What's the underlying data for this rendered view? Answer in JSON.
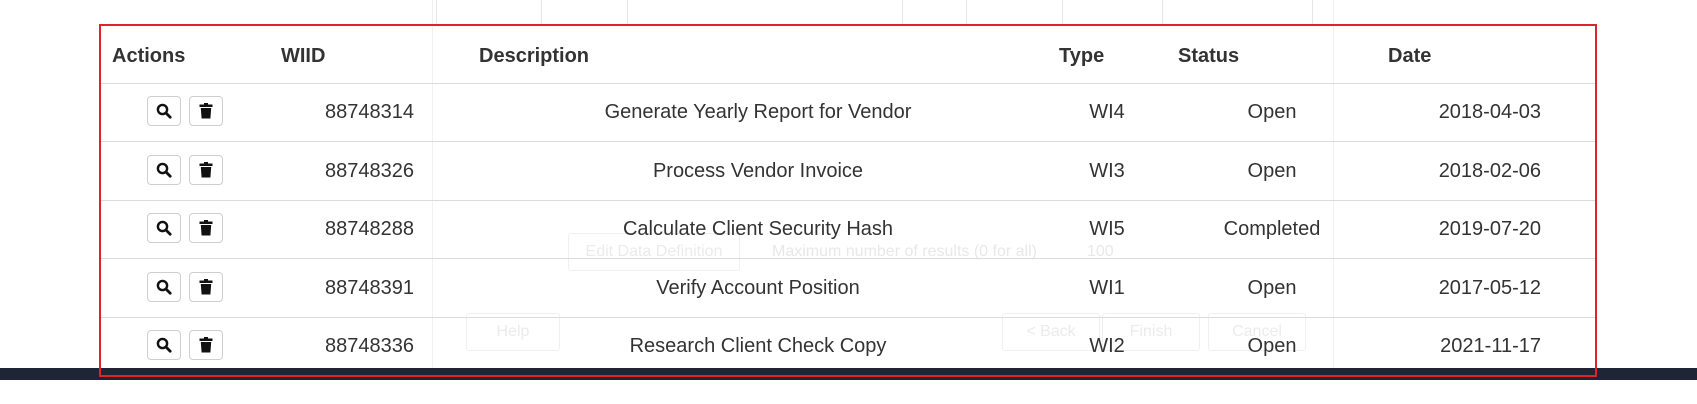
{
  "table": {
    "headers": {
      "actions": "Actions",
      "wiid": "WIID",
      "description": "Description",
      "type": "Type",
      "status": "Status",
      "date": "Date"
    },
    "rows": [
      {
        "wiid": "88748314",
        "description": "Generate Yearly Report for Vendor",
        "type": "WI4",
        "status": "Open",
        "date": "2018-04-03"
      },
      {
        "wiid": "88748326",
        "description": "Process Vendor Invoice",
        "type": "WI3",
        "status": "Open",
        "date": "2018-02-06"
      },
      {
        "wiid": "88748288",
        "description": "Calculate Client Security Hash",
        "type": "WI5",
        "status": "Completed",
        "date": "2019-07-20"
      },
      {
        "wiid": "88748391",
        "description": "Verify Account Position",
        "type": "WI1",
        "status": "Open",
        "date": "2017-05-12"
      },
      {
        "wiid": "88748336",
        "description": "Research Client Check Copy",
        "type": "WI2",
        "status": "Open",
        "date": "2021-11-17"
      }
    ],
    "row_actions": [
      "search-icon",
      "trash-icon"
    ]
  },
  "background": {
    "edit_data_definition": "Edit Data Definition",
    "max_results_label": "Maximum number of results (0 for all)",
    "max_results_value": "100",
    "help": "Help",
    "back": "< Back",
    "finish": "Finish",
    "cancel": "Cancel"
  },
  "colors": {
    "frame_border": "#e0232b",
    "footer_bar": "#1e2536"
  }
}
